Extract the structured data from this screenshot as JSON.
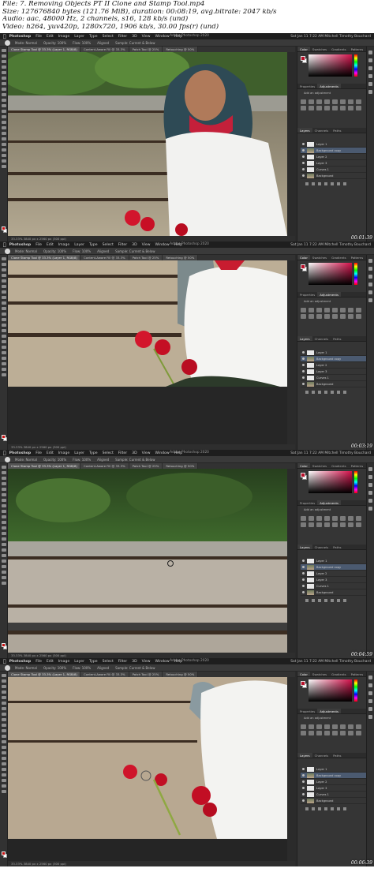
{
  "header": {
    "lines": [
      "File: 7. Removing Objects PT II  Clone and Stamp Tool.mp4",
      "Size: 127676840 bytes (121.76 MiB), duration: 00:08:19, avg.bitrate: 2047 kb/s",
      "Audio: aac, 48000 Hz, 2 channels, s16, 128 kb/s (und)",
      "Video: h264, yuv420p, 1280x720, 1906 kb/s, 30.00 fps(r) (und)"
    ]
  },
  "app": {
    "name": "Photoshop",
    "menus": [
      "File",
      "Edit",
      "Image",
      "Layer",
      "Type",
      "Select",
      "Filter",
      "3D",
      "View",
      "Window",
      "Help"
    ],
    "window_title": "Adobe Photoshop 2020",
    "clock": "Sat Jan 11  7:22 AM",
    "user": "Mitchell Timothy Bouchard"
  },
  "options_bar": {
    "items": [
      "Mode: Normal",
      "Opacity: 100%",
      "Flow: 100%",
      "Aligned",
      "Sample: Current & Below"
    ]
  },
  "tabs": [
    "Clone Stamp Tool @ 33.3% (Layer 1, RGB/8)",
    "Content-Aware Fill @ 33.3%",
    "Patch Tool @ 25%",
    "Retouching @ 50%"
  ],
  "status_text": "33.33%    3840 px x 2560 px (300 ppi)",
  "panels": {
    "top_tabs": [
      "Color",
      "Swatches",
      "Gradients",
      "Patterns"
    ],
    "mid_tabs": [
      "Properties",
      "Adjustments"
    ],
    "adjust_label": "Add an adjustment",
    "layer_tabs": [
      "Layers",
      "Channels",
      "Paths"
    ],
    "layers": [
      {
        "name": "Layer 1",
        "selected": false,
        "photo": false
      },
      {
        "name": "Background copy",
        "selected": true,
        "photo": true
      },
      {
        "name": "Layer 2",
        "selected": false,
        "photo": false
      },
      {
        "name": "Layer 3",
        "selected": false,
        "photo": false
      },
      {
        "name": "Curves 1",
        "selected": false,
        "photo": false
      },
      {
        "name": "Background",
        "selected": false,
        "photo": true
      }
    ]
  },
  "frames": [
    {
      "timestamp": "00:01:39",
      "scene": "portrait"
    },
    {
      "timestamp": "00:03:19",
      "scene": "closeup"
    },
    {
      "timestamp": "00:04:59",
      "scene": "tracks"
    },
    {
      "timestamp": "00:06:39",
      "scene": "flowers"
    }
  ],
  "colors": {
    "foreground_swatch": "#c81010",
    "ui_dark": "#2b2b2b",
    "panel": "#353535",
    "selection": "#4b5a70"
  }
}
